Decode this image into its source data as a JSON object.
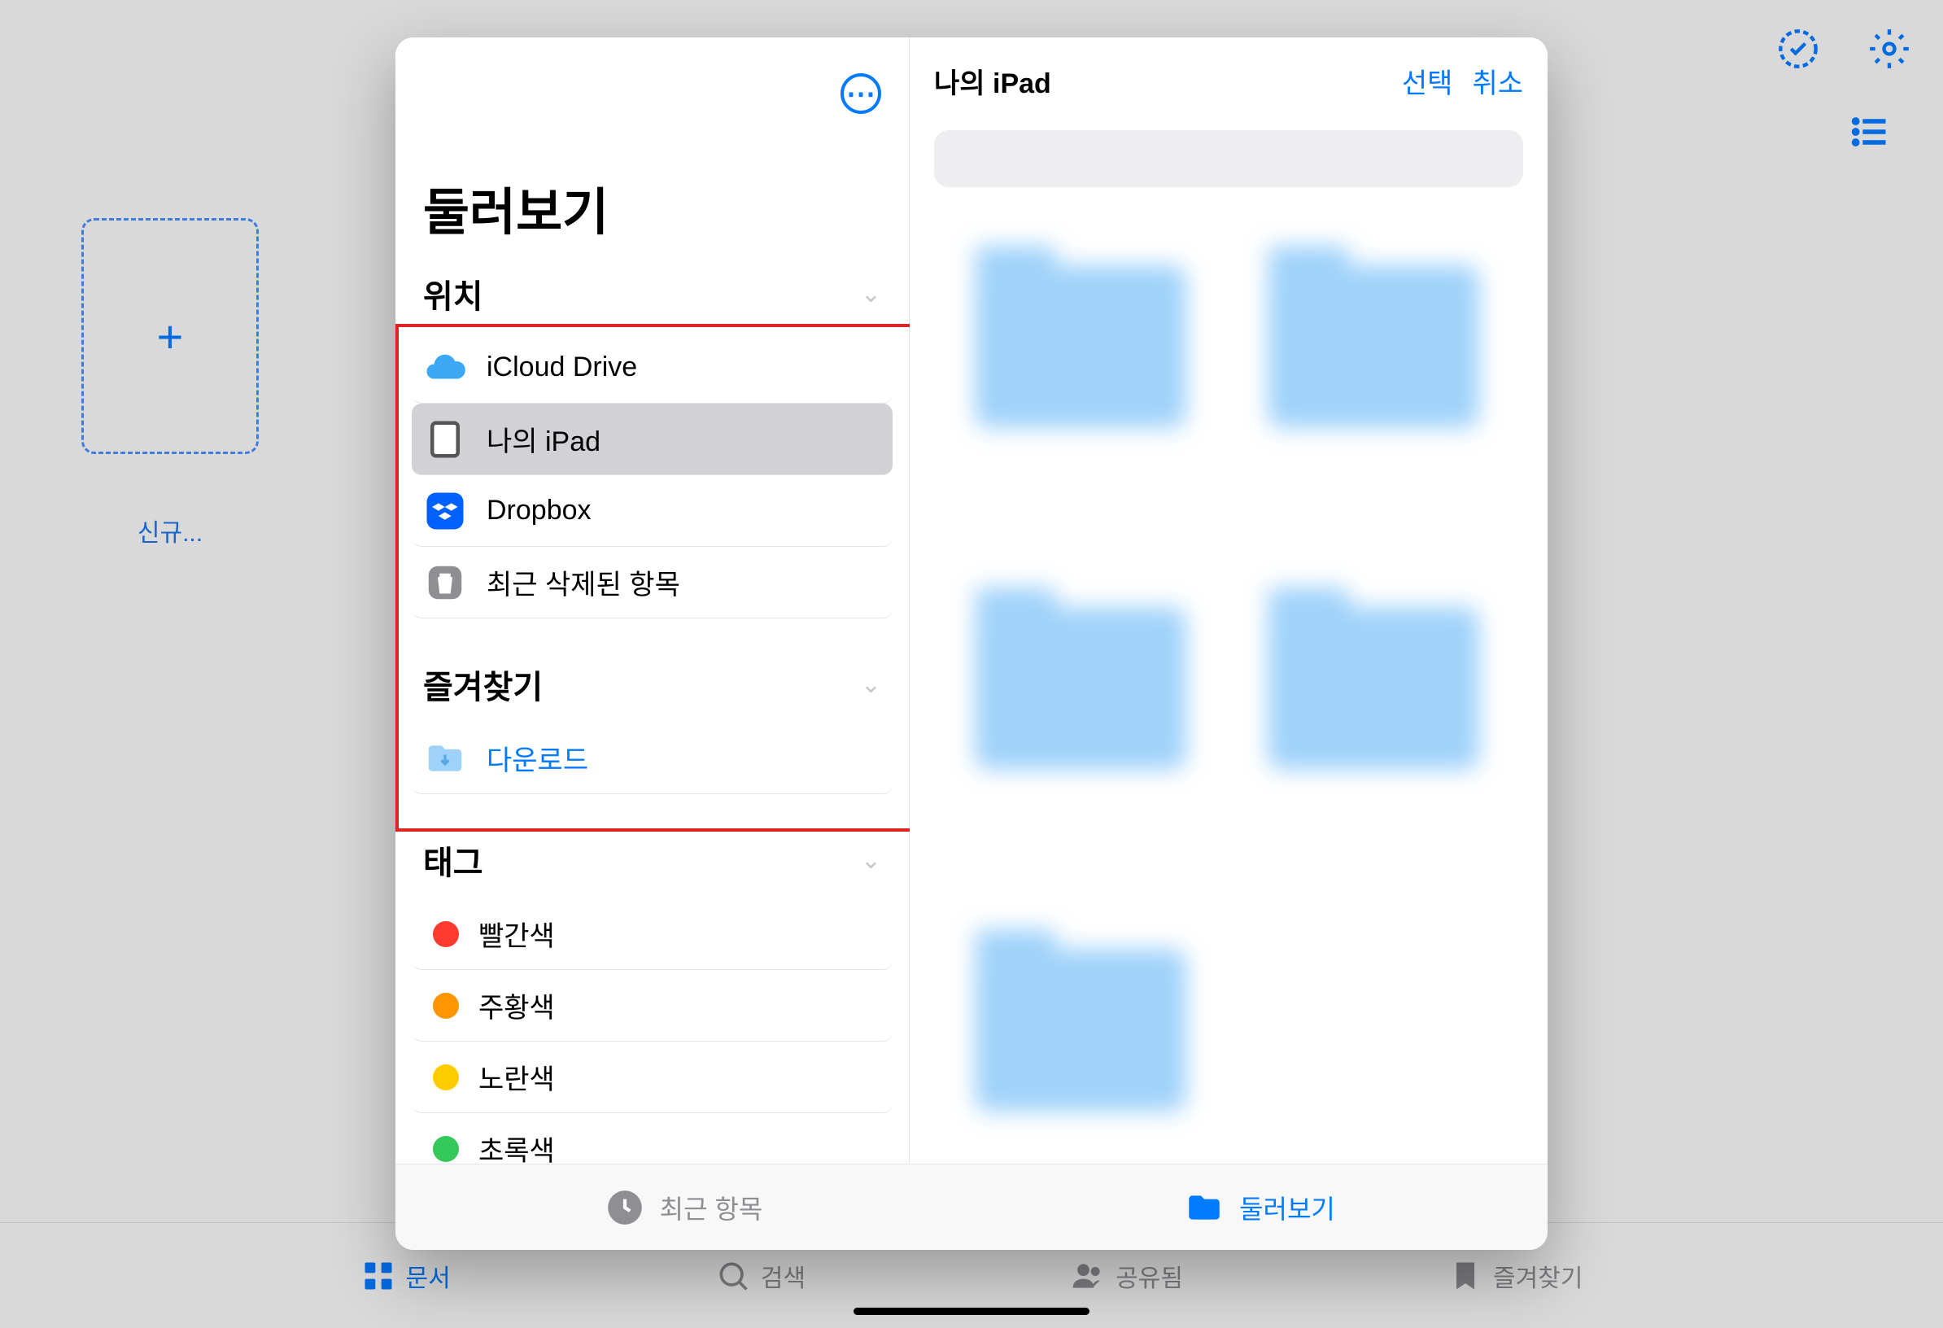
{
  "bg": {
    "new_label": "신규...",
    "tabs": [
      {
        "label": "문서",
        "icon": "grid-icon",
        "active": true
      },
      {
        "label": "검색",
        "icon": "search-icon",
        "active": false
      },
      {
        "label": "공유됨",
        "icon": "people-icon",
        "active": false
      },
      {
        "label": "즐겨찾기",
        "icon": "bookmark-icon",
        "active": false
      }
    ]
  },
  "sidebar": {
    "title": "둘러보기",
    "sections": {
      "locations": {
        "label": "위치",
        "items": [
          {
            "label": "iCloud Drive",
            "icon": "cloud-icon",
            "selected": false
          },
          {
            "label": "나의 iPad",
            "icon": "ipad-icon",
            "selected": true
          },
          {
            "label": "Dropbox",
            "icon": "dropbox-icon",
            "selected": false
          },
          {
            "label": "최근 삭제된 항목",
            "icon": "trash-icon",
            "selected": false
          }
        ]
      },
      "favorites": {
        "label": "즐겨찾기",
        "items": [
          {
            "label": "다운로드",
            "icon": "download-folder-icon"
          }
        ]
      },
      "tags": {
        "label": "태그",
        "items": [
          {
            "label": "빨간색",
            "color": "#ff3b30"
          },
          {
            "label": "주황색",
            "color": "#ff9500"
          },
          {
            "label": "노란색",
            "color": "#ffcc00"
          },
          {
            "label": "초록색",
            "color": "#34c759"
          }
        ]
      }
    }
  },
  "content": {
    "title": "나의 iPad",
    "select": "선택",
    "cancel": "취소"
  },
  "sheet_tabs": {
    "recent": "최근 항목",
    "browse": "둘러보기"
  }
}
